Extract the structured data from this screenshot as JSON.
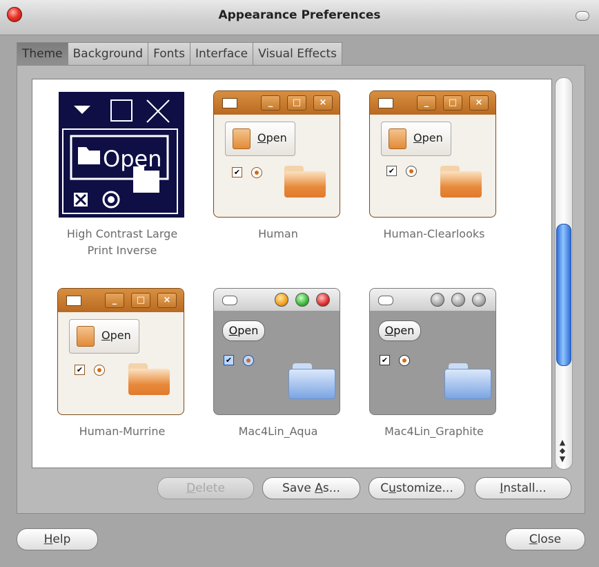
{
  "window": {
    "title": "Appearance Preferences"
  },
  "tabs": [
    "Theme",
    "Background",
    "Fonts",
    "Interface",
    "Visual Effects"
  ],
  "themes": [
    {
      "name": "High Contrast Large Print Inverse",
      "line1": "High Contrast Large",
      "line2": "Print Inverse"
    },
    {
      "name": "Human"
    },
    {
      "name": "Human-Clearlooks"
    },
    {
      "name": "Human-Murrine"
    },
    {
      "name": "Mac4Lin_Aqua"
    },
    {
      "name": "Mac4Lin_Graphite"
    }
  ],
  "preview": {
    "open_label": "Open",
    "open_mnemonic": "O",
    "open_rest": "pen"
  },
  "buttons": {
    "delete": {
      "mn": "D",
      "rest": "elete"
    },
    "save_as": {
      "pre": "Save ",
      "mn": "A",
      "rest": "s..."
    },
    "customize": {
      "pre": "C",
      "mn": "u",
      "rest": "stomize..."
    },
    "install": {
      "mn": "I",
      "rest": "nstall..."
    },
    "help": {
      "mn": "H",
      "rest": "elp"
    },
    "close": {
      "mn": "C",
      "rest": "lose"
    }
  },
  "colors": {
    "human_accent": "#d36c16",
    "aqua_blue": "#2f6fd9",
    "hc_bg": "#0f0f45"
  }
}
